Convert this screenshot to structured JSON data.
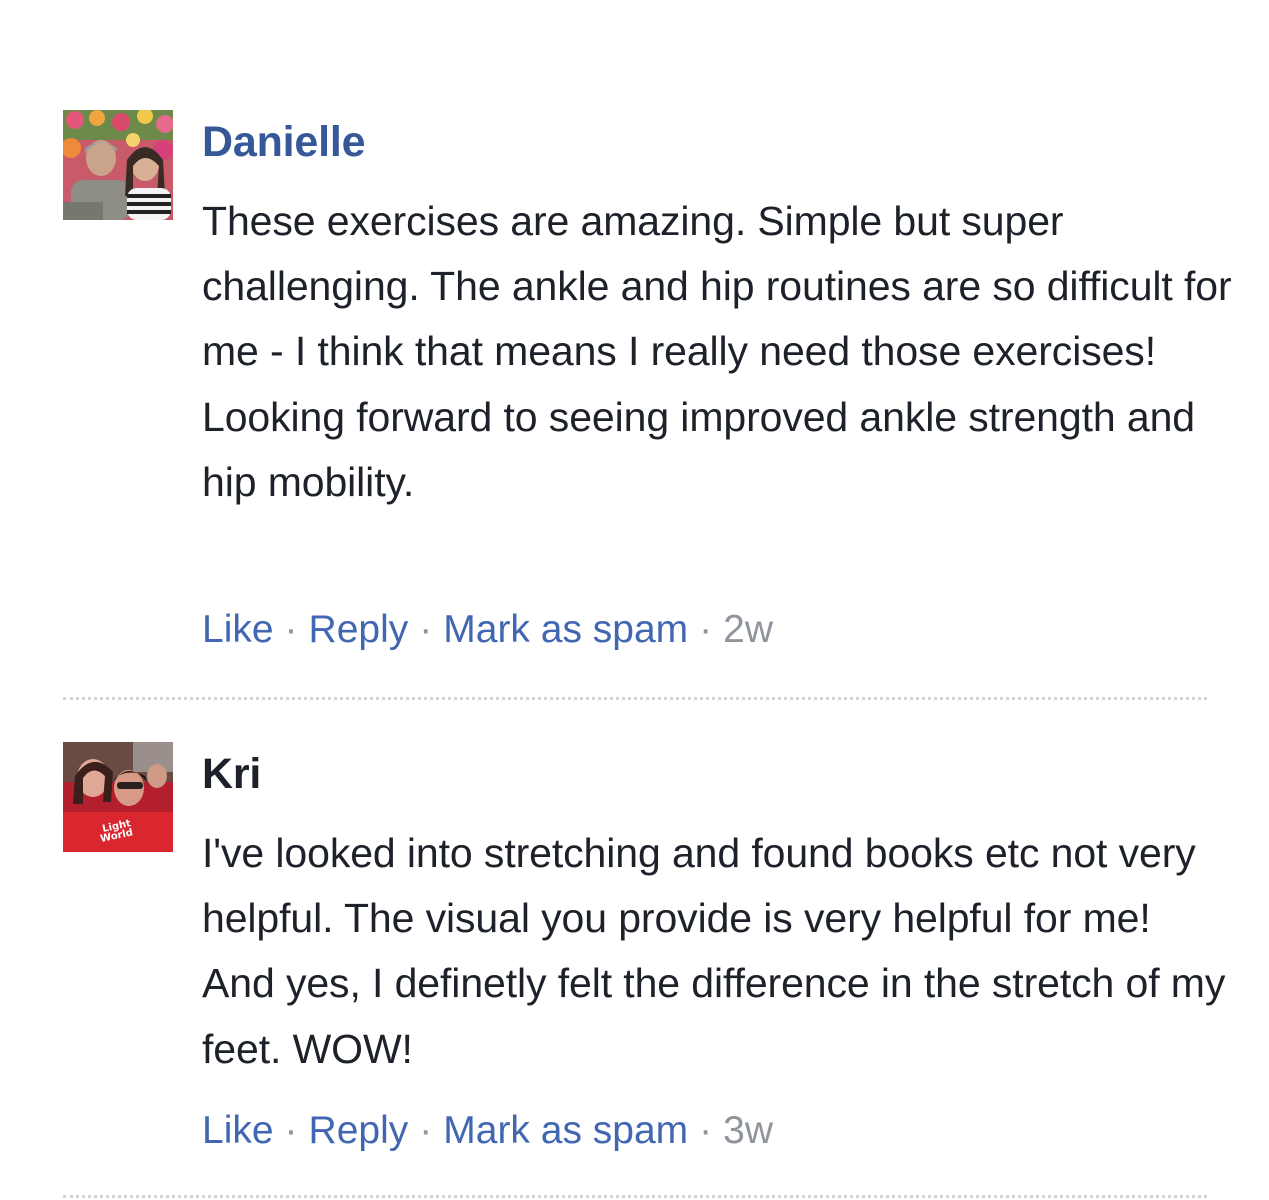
{
  "comments": [
    {
      "author": "Danielle",
      "text": "These exercises are amazing. Simple but super challenging. The ankle and hip routines are so difficult for me - I think that means I really need those exercises! Looking forward to seeing improved ankle strength and hip mobility.",
      "like_label": "Like",
      "reply_label": "Reply",
      "spam_label": "Mark as spam",
      "separator": "·",
      "time": "2w"
    },
    {
      "author": "Kri",
      "text": "I've looked into stretching and found books etc not very helpful. The visual you provide is very helpful for me! And yes, I definetly felt the difference in the stretch of my feet. WOW!",
      "like_label": "Like",
      "reply_label": "Reply",
      "spam_label": "Mark as spam",
      "separator": "·",
      "time": "3w"
    }
  ],
  "colors": {
    "link": "#4267b2",
    "author_link": "#365899",
    "text": "#1d2129",
    "muted": "#90949c",
    "divider": "#d0d3d8"
  }
}
